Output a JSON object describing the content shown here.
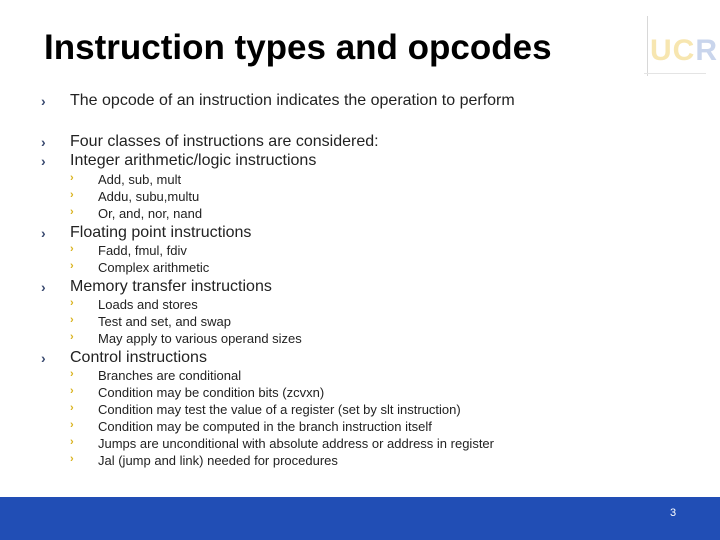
{
  "slide": {
    "title": "Instruction types and opcodes",
    "logo": {
      "u": "U",
      "c": "C",
      "r": "R"
    },
    "page_number": "3",
    "bullets": [
      {
        "level": 1,
        "text": "The opcode of an instruction indicates the operation to perform"
      },
      {
        "level": 1,
        "text": "Four classes of instructions are considered:"
      },
      {
        "level": 1,
        "text": "Integer arithmetic/logic instructions"
      },
      {
        "level": 2,
        "text": "Add, sub, mult"
      },
      {
        "level": 2,
        "text": "Addu, subu,multu"
      },
      {
        "level": 2,
        "text": "Or, and, nor, nand"
      },
      {
        "level": 1,
        "text": "Floating point instructions"
      },
      {
        "level": 2,
        "text": "Fadd, fmul, fdiv"
      },
      {
        "level": 2,
        "text": "Complex arithmetic"
      },
      {
        "level": 1,
        "text": "Memory transfer instructions"
      },
      {
        "level": 2,
        "text": "Loads and stores"
      },
      {
        "level": 2,
        "text": "Test and set, and swap"
      },
      {
        "level": 2,
        "text": "May apply to various operand sizes"
      },
      {
        "level": 1,
        "text": "Control instructions"
      },
      {
        "level": 2,
        "text": "Branches are conditional"
      },
      {
        "level": 2,
        "text": "Condition may be condition bits (zcvxn)"
      },
      {
        "level": 2,
        "text": "Condition may test the value of a register (set by slt instruction)"
      },
      {
        "level": 2,
        "text": "Condition may be computed in the branch instruction itself"
      },
      {
        "level": 2,
        "text": "Jumps are unconditional with absolute address or address in register"
      },
      {
        "level": 2,
        "text": "Jal (jump and link) needed for procedures"
      }
    ],
    "chevron_glyph": "›"
  }
}
